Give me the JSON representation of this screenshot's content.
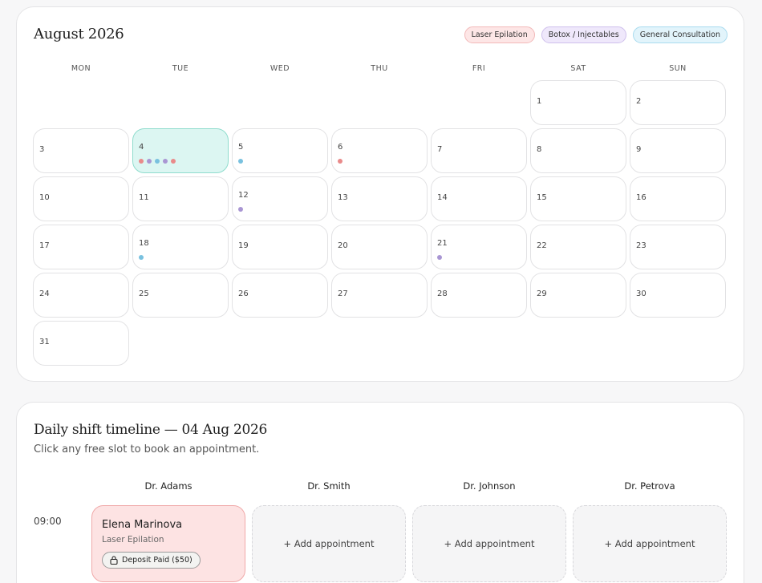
{
  "calendar": {
    "title": "August 2026",
    "legend": [
      {
        "label": "Laser Epilation",
        "key": "laser"
      },
      {
        "label": "Botox / Injectables",
        "key": "botox"
      },
      {
        "label": "General Consultation",
        "key": "consult"
      }
    ],
    "weekdays": [
      "MON",
      "TUE",
      "WED",
      "THU",
      "FRI",
      "SAT",
      "SUN"
    ],
    "leading_empty_days": 5,
    "days_in_month": 31,
    "selected_day": 4,
    "events": {
      "4": [
        "laser",
        "botox",
        "consult",
        "botox",
        "laser"
      ],
      "5": [
        "consult"
      ],
      "6": [
        "laser"
      ],
      "12": [
        "botox"
      ],
      "18": [
        "consult"
      ],
      "21": [
        "botox"
      ]
    }
  },
  "colors": {
    "laser": "#e98a8a",
    "botox": "#a996d3",
    "consult": "#79c1df"
  },
  "timeline": {
    "title": "Daily shift timeline — 04 Aug 2026",
    "subtitle": "Click any free slot to book an appointment.",
    "doctors": [
      "Dr. Adams",
      "Dr. Smith",
      "Dr. Johnson",
      "Dr. Petrova"
    ],
    "time": "09:00",
    "booking": {
      "patient": "Elena Marinova",
      "service": "Laser Epilation",
      "deposit_label": "Deposit Paid ($50)"
    },
    "add_label": "+ Add appointment"
  }
}
